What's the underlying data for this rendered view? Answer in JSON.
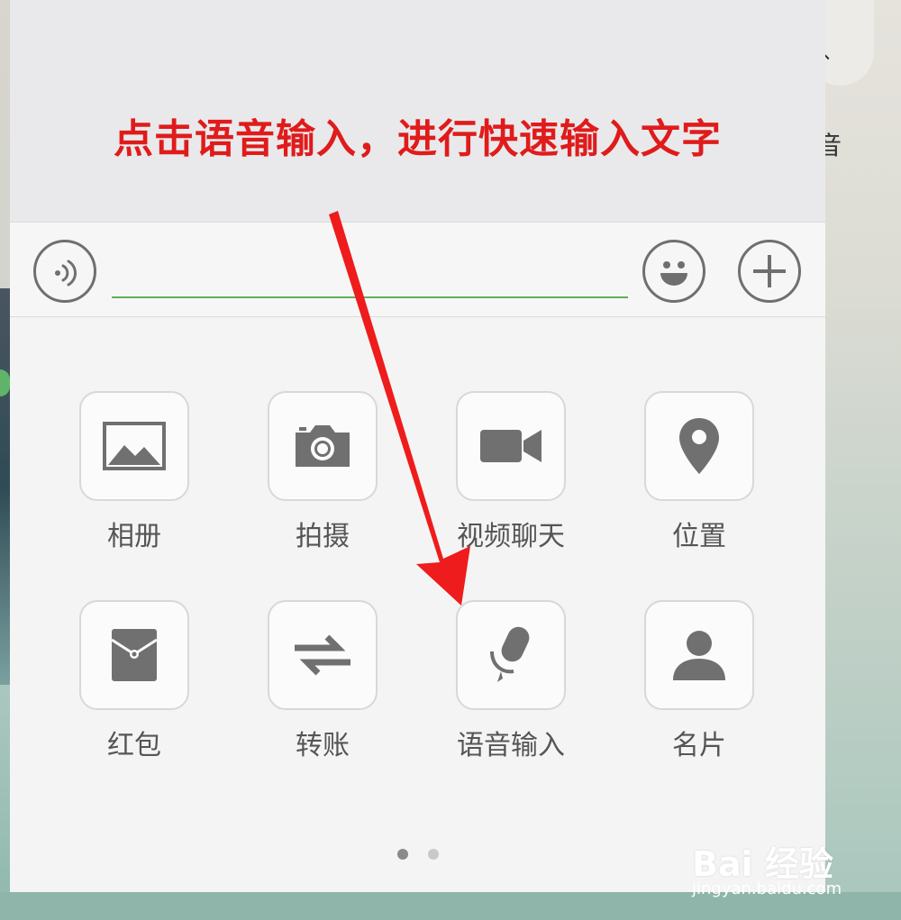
{
  "annotation": "点击语音输入，进行快速输入文字",
  "background": {
    "partial_text": "音"
  },
  "input_bar": {
    "placeholder": "",
    "voice_icon": "voice-wave-icon",
    "emoji_icon": "smiley-face-icon",
    "plus_icon": "plus-icon"
  },
  "tools": {
    "row1": [
      {
        "label": "相册",
        "icon": "photo-album-icon"
      },
      {
        "label": "拍摄",
        "icon": "camera-icon"
      },
      {
        "label": "视频聊天",
        "icon": "video-camera-icon"
      },
      {
        "label": "位置",
        "icon": "location-pin-icon"
      }
    ],
    "row2": [
      {
        "label": "红包",
        "icon": "red-packet-icon"
      },
      {
        "label": "转账",
        "icon": "transfer-arrows-icon"
      },
      {
        "label": "语音输入",
        "icon": "microphone-icon"
      },
      {
        "label": "名片",
        "icon": "contact-card-icon"
      }
    ]
  },
  "pager": {
    "pages": 2,
    "current": 1
  },
  "watermark": {
    "brand": "Bai 经验",
    "url": "jingyan.baidu.com"
  },
  "colors": {
    "annotation": "#e01b1b",
    "input_underline": "#5fb05a",
    "icon_gray": "#707070"
  }
}
